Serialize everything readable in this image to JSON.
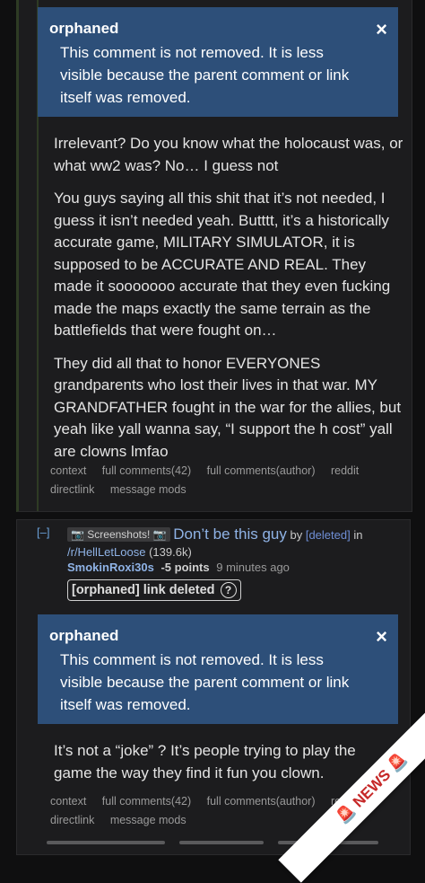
{
  "comment1": {
    "notice": {
      "title": "orphaned",
      "text": "This comment is not removed. It is less visible because the parent comment or link itself was removed.",
      "close_symbol": "×"
    },
    "paragraphs": [
      "Irrelevant? Do you know what the holocaust was, or what ww2 was? No… I guess not",
      "You guys saying all this shit that it’s not needed, I guess it isn’t needed yeah. Butttt, it’s a historically accurate game, MILITARY SIMULATOR, it is supposed to be ACCURATE AND REAL. They made it sooooooo accurate that they even fucking made the maps exactly the same terrain as the battlefields that were fought on…",
      "They did all that to honor EVERYONES grandparents who lost their lives in that war. MY GRANDFATHER fought in the war for the allies, but yeah like yall wanna say, “I support the h cost” yall are clowns lmfao"
    ],
    "links": [
      "context",
      "full comments(42)",
      "full comments(author)",
      "reddit",
      "directlink",
      "message mods"
    ]
  },
  "comment2": {
    "collapse": "[–]",
    "flair": "📷 Screenshots! 📷",
    "post_title": "Don’t be this guy",
    "by": "by",
    "deleted": "[deleted]",
    "in": "in",
    "subreddit": "/r/HellLetLoose",
    "subscribers": "(139.6k)",
    "author": "SmokinRoxi30s",
    "points": "-5 points",
    "time": "9 minutes ago",
    "orphaned_link": "[orphaned] link deleted",
    "help_symbol": "?",
    "notice": {
      "title": "orphaned",
      "text": "This comment is not removed. It is less visible because the parent comment or link itself was removed.",
      "close_symbol": "×"
    },
    "paragraphs": [
      "It’s not a “joke” ? It’s people trying to play the game the way they find it fun you clown."
    ],
    "links": [
      "context",
      "full comments(42)",
      "full comments(author)",
      "reddit",
      "directlink",
      "message mods"
    ]
  },
  "watermark": {
    "text": "🚨 NEWS 🚨"
  },
  "colors": {
    "notice_bg": "#2d4f79",
    "link": "#8fb3e6",
    "background": "#0f0f10"
  }
}
